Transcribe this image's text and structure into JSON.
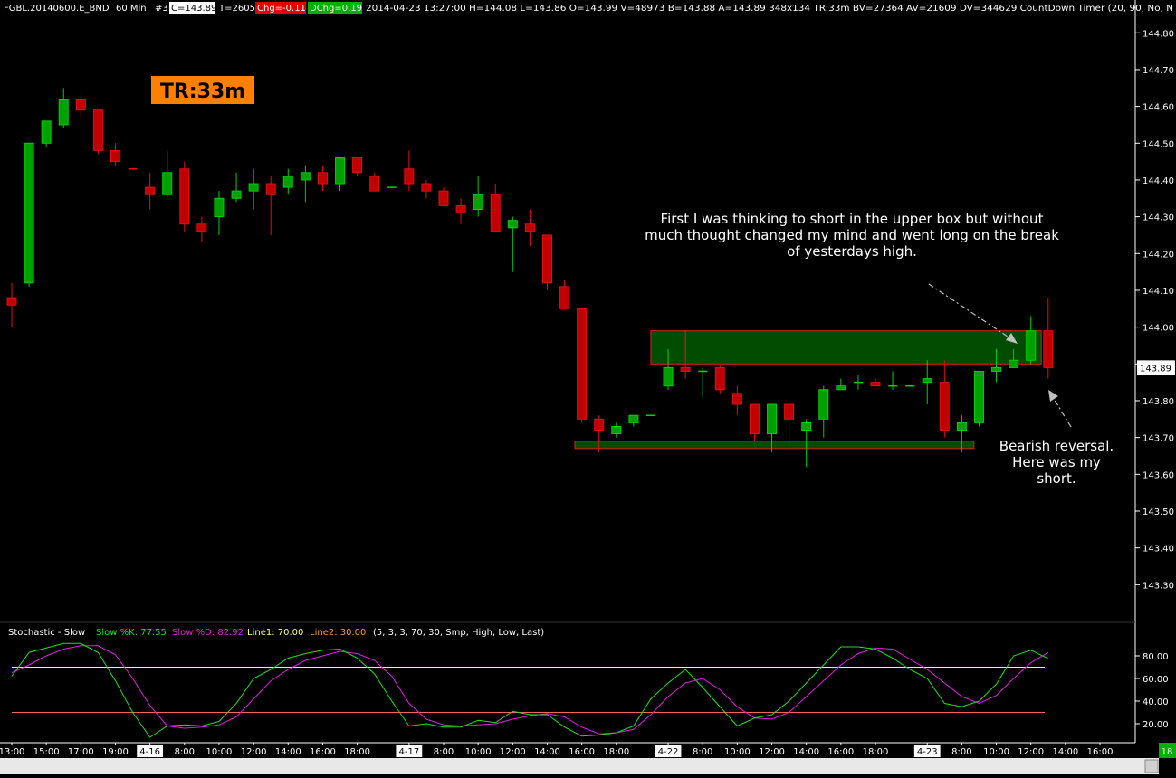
{
  "header": {
    "symbol": "FGBL.20140600.E_BND",
    "interval": "60 Min",
    "count": "#3",
    "close_label": "C=143.89",
    "ticks_label": "T=2605",
    "chg_label": "Chg=-0.11",
    "dchg_label": "DChg=0.19",
    "rest": "2014-04-23 13:27:00 H=144.08 L=143.86 O=143.99 V=48973 B=143.88 A=143.89 348x134 TR:33m BV=27364 AV=21609 DV=344629 CountDown Timer (20, 90, No, N",
    "colors": {
      "chg_bg": "#e00000",
      "dchg_bg": "#00b000",
      "close_bg": "#ffffff"
    }
  },
  "timer_badge": {
    "text": "TR:33m",
    "bg": "#ff7f00"
  },
  "last_price_label": "143.89",
  "annotations": {
    "top_note": [
      "First I was thinking to short in the upper box but without",
      "much thought changed my mind and went long on the break",
      "of yesterdays high."
    ],
    "bottom_note": [
      "Bearish reversal.",
      "Here was my",
      "short."
    ]
  },
  "chart_data": {
    "type": "candlestick",
    "colors": {
      "up": "#00d000",
      "up_fill": "#00a000",
      "down": "#e01010",
      "down_fill": "#c00000",
      "axis": "#ffffff",
      "bg": "#000000"
    },
    "y_ticks": [
      "144.80",
      "144.70",
      "144.60",
      "144.50",
      "144.40",
      "144.30",
      "144.20",
      "144.10",
      "144.00",
      "143.90",
      "143.80",
      "143.70",
      "143.60",
      "143.50",
      "143.40",
      "143.30"
    ],
    "ylim": [
      143.2,
      144.84
    ],
    "x_labels": [
      {
        "i": 0,
        "t": "13:00"
      },
      {
        "i": 2,
        "t": "15:00"
      },
      {
        "i": 4,
        "t": "17:00"
      },
      {
        "i": 6,
        "t": "19:00"
      },
      {
        "i": 8,
        "t": "4-16",
        "box": true
      },
      {
        "i": 10,
        "t": "8:00"
      },
      {
        "i": 12,
        "t": "10:00"
      },
      {
        "i": 14,
        "t": "12:00"
      },
      {
        "i": 16,
        "t": "14:00"
      },
      {
        "i": 18,
        "t": "16:00"
      },
      {
        "i": 20,
        "t": "18:00"
      },
      {
        "i": 23,
        "t": "4-17",
        "box": true
      },
      {
        "i": 25,
        "t": "8:00"
      },
      {
        "i": 27,
        "t": "10:00"
      },
      {
        "i": 29,
        "t": "12:00"
      },
      {
        "i": 31,
        "t": "14:00"
      },
      {
        "i": 33,
        "t": "16:00"
      },
      {
        "i": 35,
        "t": "18:00"
      },
      {
        "i": 38,
        "t": "4-22",
        "box": true
      },
      {
        "i": 40,
        "t": "8:00"
      },
      {
        "i": 42,
        "t": "10:00"
      },
      {
        "i": 44,
        "t": "12:00"
      },
      {
        "i": 46,
        "t": "14:00"
      },
      {
        "i": 48,
        "t": "16:00"
      },
      {
        "i": 50,
        "t": "18:00"
      },
      {
        "i": 53,
        "t": "4-23",
        "box": true
      },
      {
        "i": 55,
        "t": "8:00"
      },
      {
        "i": 57,
        "t": "10:00"
      },
      {
        "i": 59,
        "t": "12:00"
      },
      {
        "i": 61,
        "t": "14:00"
      },
      {
        "i": 63,
        "t": "16:00"
      }
    ],
    "candles": [
      [
        144.08,
        144.12,
        144.0,
        144.06
      ],
      [
        144.12,
        144.11,
        144.12,
        144.5
      ],
      [
        144.5,
        144.52,
        144.49,
        144.56
      ],
      [
        144.55,
        144.65,
        144.54,
        144.62
      ],
      [
        144.62,
        144.63,
        144.57,
        144.59
      ],
      [
        144.59,
        144.59,
        144.47,
        144.48
      ],
      [
        144.48,
        144.5,
        144.44,
        144.45
      ],
      [
        144.43,
        144.43,
        144.43,
        144.43
      ],
      [
        144.38,
        144.42,
        144.32,
        144.36
      ],
      [
        144.36,
        144.48,
        144.35,
        144.42
      ],
      [
        144.43,
        144.45,
        144.26,
        144.28
      ],
      [
        144.28,
        144.3,
        144.23,
        144.26
      ],
      [
        144.3,
        144.37,
        144.25,
        144.35
      ],
      [
        144.35,
        144.42,
        144.34,
        144.37
      ],
      [
        144.37,
        144.43,
        144.32,
        144.39
      ],
      [
        144.39,
        144.41,
        144.25,
        144.36
      ],
      [
        144.38,
        144.43,
        144.36,
        144.41
      ],
      [
        144.4,
        144.44,
        144.34,
        144.42
      ],
      [
        144.42,
        144.44,
        144.37,
        144.39
      ],
      [
        144.39,
        144.46,
        144.37,
        144.46
      ],
      [
        144.46,
        144.46,
        144.41,
        144.42
      ],
      [
        144.41,
        144.42,
        144.37,
        144.37
      ],
      [
        144.38,
        144.38,
        144.38,
        144.38
      ],
      [
        144.43,
        144.48,
        144.37,
        144.39
      ],
      [
        144.39,
        144.4,
        144.35,
        144.37
      ],
      [
        144.37,
        144.38,
        144.33,
        144.33
      ],
      [
        144.33,
        144.35,
        144.28,
        144.31
      ],
      [
        144.32,
        144.41,
        144.3,
        144.36
      ],
      [
        144.36,
        144.39,
        144.28,
        144.26
      ],
      [
        144.27,
        144.3,
        144.15,
        144.29
      ],
      [
        144.28,
        144.32,
        144.22,
        144.26
      ],
      [
        144.25,
        144.25,
        144.1,
        144.12
      ],
      [
        144.11,
        144.13,
        144.06,
        144.05
      ],
      [
        144.05,
        144.05,
        143.74,
        143.75
      ],
      [
        143.75,
        143.76,
        143.66,
        143.72
      ],
      [
        143.71,
        143.74,
        143.7,
        143.73
      ],
      [
        143.74,
        143.76,
        143.73,
        143.76
      ],
      [
        143.76,
        143.76,
        143.76,
        143.76
      ],
      [
        143.84,
        143.94,
        143.83,
        143.89
      ],
      [
        143.89,
        143.9,
        143.86,
        143.88
      ],
      [
        143.88,
        143.89,
        143.81,
        143.88
      ],
      [
        143.89,
        143.9,
        143.82,
        143.83
      ],
      [
        143.82,
        143.84,
        143.76,
        143.79
      ],
      [
        143.79,
        143.79,
        143.69,
        143.71
      ],
      [
        143.71,
        143.79,
        143.66,
        143.79
      ],
      [
        143.79,
        143.79,
        143.68,
        143.75
      ],
      [
        143.72,
        143.75,
        143.62,
        143.74
      ],
      [
        143.75,
        143.84,
        143.7,
        143.83
      ],
      [
        143.83,
        143.86,
        143.83,
        143.84
      ],
      [
        143.85,
        143.87,
        143.83,
        143.85
      ],
      [
        143.85,
        143.86,
        143.84,
        143.84
      ],
      [
        143.84,
        143.88,
        143.83,
        143.84
      ],
      [
        143.84,
        143.84,
        143.84,
        143.84
      ],
      [
        143.85,
        143.91,
        143.79,
        143.86
      ],
      [
        143.85,
        143.91,
        143.7,
        143.72
      ],
      [
        143.72,
        143.76,
        143.66,
        143.74
      ],
      [
        143.74,
        143.88,
        143.73,
        143.88
      ],
      [
        143.88,
        143.94,
        143.85,
        143.89
      ],
      [
        143.89,
        143.94,
        143.89,
        143.91
      ],
      [
        143.91,
        144.03,
        143.9,
        143.99
      ],
      [
        143.99,
        144.08,
        143.86,
        143.89
      ]
    ],
    "boxes": [
      {
        "x0": 37.0,
        "x1": 59.6,
        "top": 143.99,
        "bottom": 143.9,
        "divider": 39.0
      },
      {
        "x0": 32.6,
        "x1": 55.7,
        "top": 143.69,
        "bottom": 143.67
      }
    ],
    "stochastic": {
      "title": "Stochastic - Slow",
      "k_label": "Slow %K: 77.55",
      "d_label": "Slow %D: 82.92",
      "line1_label": "Line1: 70.00",
      "line2_label": "Line2: 30.00",
      "params_label": "(5, 3, 3, 70, 30, Smp, High, Low, Last)",
      "ticks": [
        "80.00",
        "60.00",
        "40.00",
        "20.00"
      ],
      "line1": 70,
      "line2": 30,
      "k_color": "#20e020",
      "d_color": "#e020e0",
      "line1_color": "#ffff80",
      "line2_color": "#ff6060",
      "k": [
        62,
        83,
        87,
        91,
        91,
        83,
        58,
        30,
        8,
        18,
        19,
        18,
        22,
        38,
        60,
        68,
        78,
        82,
        85,
        86,
        78,
        64,
        40,
        18,
        20,
        17,
        17,
        23,
        21,
        31,
        28,
        28,
        17,
        9,
        10,
        12,
        18,
        42,
        56,
        68,
        52,
        35,
        18,
        25,
        28,
        40,
        56,
        72,
        88,
        88,
        86,
        78,
        68,
        60,
        38,
        35,
        40,
        55,
        80,
        85,
        77.55
      ],
      "d": [
        65,
        72,
        80,
        86,
        89,
        89,
        81,
        60,
        36,
        18,
        16,
        17,
        19,
        26,
        42,
        58,
        68,
        76,
        80,
        84,
        82,
        76,
        62,
        38,
        24,
        19,
        18,
        19,
        20,
        24,
        27,
        29,
        26,
        17,
        11,
        12,
        15,
        28,
        44,
        56,
        60,
        50,
        35,
        25,
        24,
        30,
        44,
        58,
        72,
        82,
        87,
        86,
        77,
        68,
        56,
        44,
        38,
        45,
        60,
        74,
        82.92
      ]
    }
  }
}
